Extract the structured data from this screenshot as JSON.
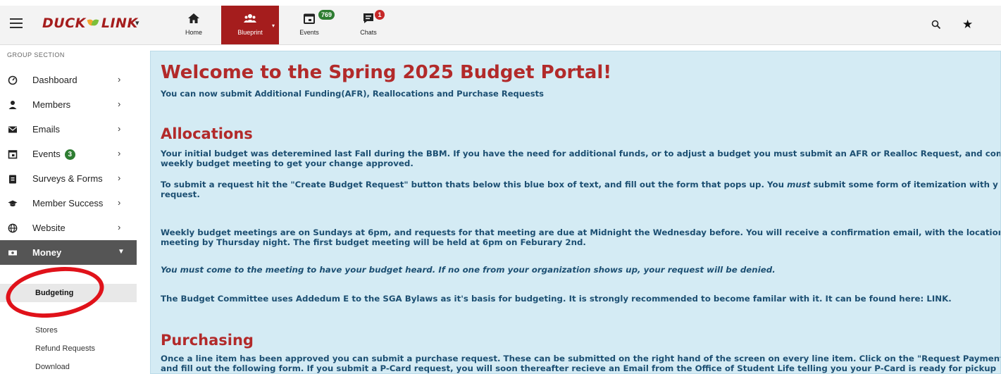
{
  "header": {
    "logo_left": "DUCK",
    "logo_right": "LINK",
    "nav": [
      {
        "label": "Home"
      },
      {
        "label": "Blueprint"
      },
      {
        "label": "Events",
        "badge": "769"
      },
      {
        "label": "Chats",
        "badge": "1"
      }
    ],
    "colors": {
      "brand": "#a51d1d",
      "badge_green": "#2e7d32",
      "badge_red": "#c62828"
    }
  },
  "sidebar": {
    "group_label": "GROUP SECTION",
    "items": [
      {
        "label": "Dashboard",
        "icon": "dashboard-icon"
      },
      {
        "label": "Members",
        "icon": "person-icon"
      },
      {
        "label": "Emails",
        "icon": "envelope-icon"
      },
      {
        "label": "Events",
        "icon": "calendar-icon",
        "badge": "3"
      },
      {
        "label": "Surveys & Forms",
        "icon": "clipboard-icon"
      },
      {
        "label": "Member Success",
        "icon": "graduation-cap-icon"
      },
      {
        "label": "Website",
        "icon": "globe-icon"
      },
      {
        "label": "Money",
        "icon": "money-icon"
      }
    ],
    "money_sub": [
      {
        "label": "Budgeting"
      },
      {
        "label": "Stores"
      },
      {
        "label": "Refund Requests"
      },
      {
        "label": "Download"
      }
    ]
  },
  "main": {
    "title": "Welcome to the Spring 2025 Budget Portal!",
    "subtitle": "You can now submit Additional Funding(AFR), Reallocations and Purchase Requests",
    "allocations_heading": "Allocations",
    "p1_line1": "Your initial budget was deteremined last Fall during the BBM. If you have the need for additional funds, or to adjust a budget you must submit an AFR or Realloc Request, and com",
    "p1_line2": "weekly budget meeting to get your change approved.",
    "p2_line1_a": "To submit a request hit the \"Create Budget Request\" button thats below this blue box of text, and fill out the form that pops up. You ",
    "p2_line1_em": "must",
    "p2_line1_b": " submit some form of itemization with y",
    "p2_line2": "request.",
    "p3_line1": "Weekly budget meetings are on Sundays at 6pm, and requests for that meeting are due at Midnight the Wednesday before. You will receive a confirmation email, with the location",
    "p3_line2": "meeting by Thursday night. The first budget meeting will be held at 6pm on Feburary 2nd.",
    "p4": "You must come to the meeting to have your budget heard. If no one from your organization shows up, your request will be denied.",
    "p5": "The Budget Committee uses Addedum E to the SGA Bylaws as it's basis for budgeting. It is strongly recommended to become familar with it. It can be found here: LINK.",
    "purchasing_heading": "Purchasing",
    "p6_line1": "Once a line item has been approved you can submit a purchase request. These can be submitted on the right hand of the screen on every line item. Click on the \"Request Payment\"",
    "p6_line2": "and fill out the following form. If you submit a P-Card request, you will soon thereafter recieve an Email from the Office of Student Life telling you your P-Card is ready for pickup"
  }
}
